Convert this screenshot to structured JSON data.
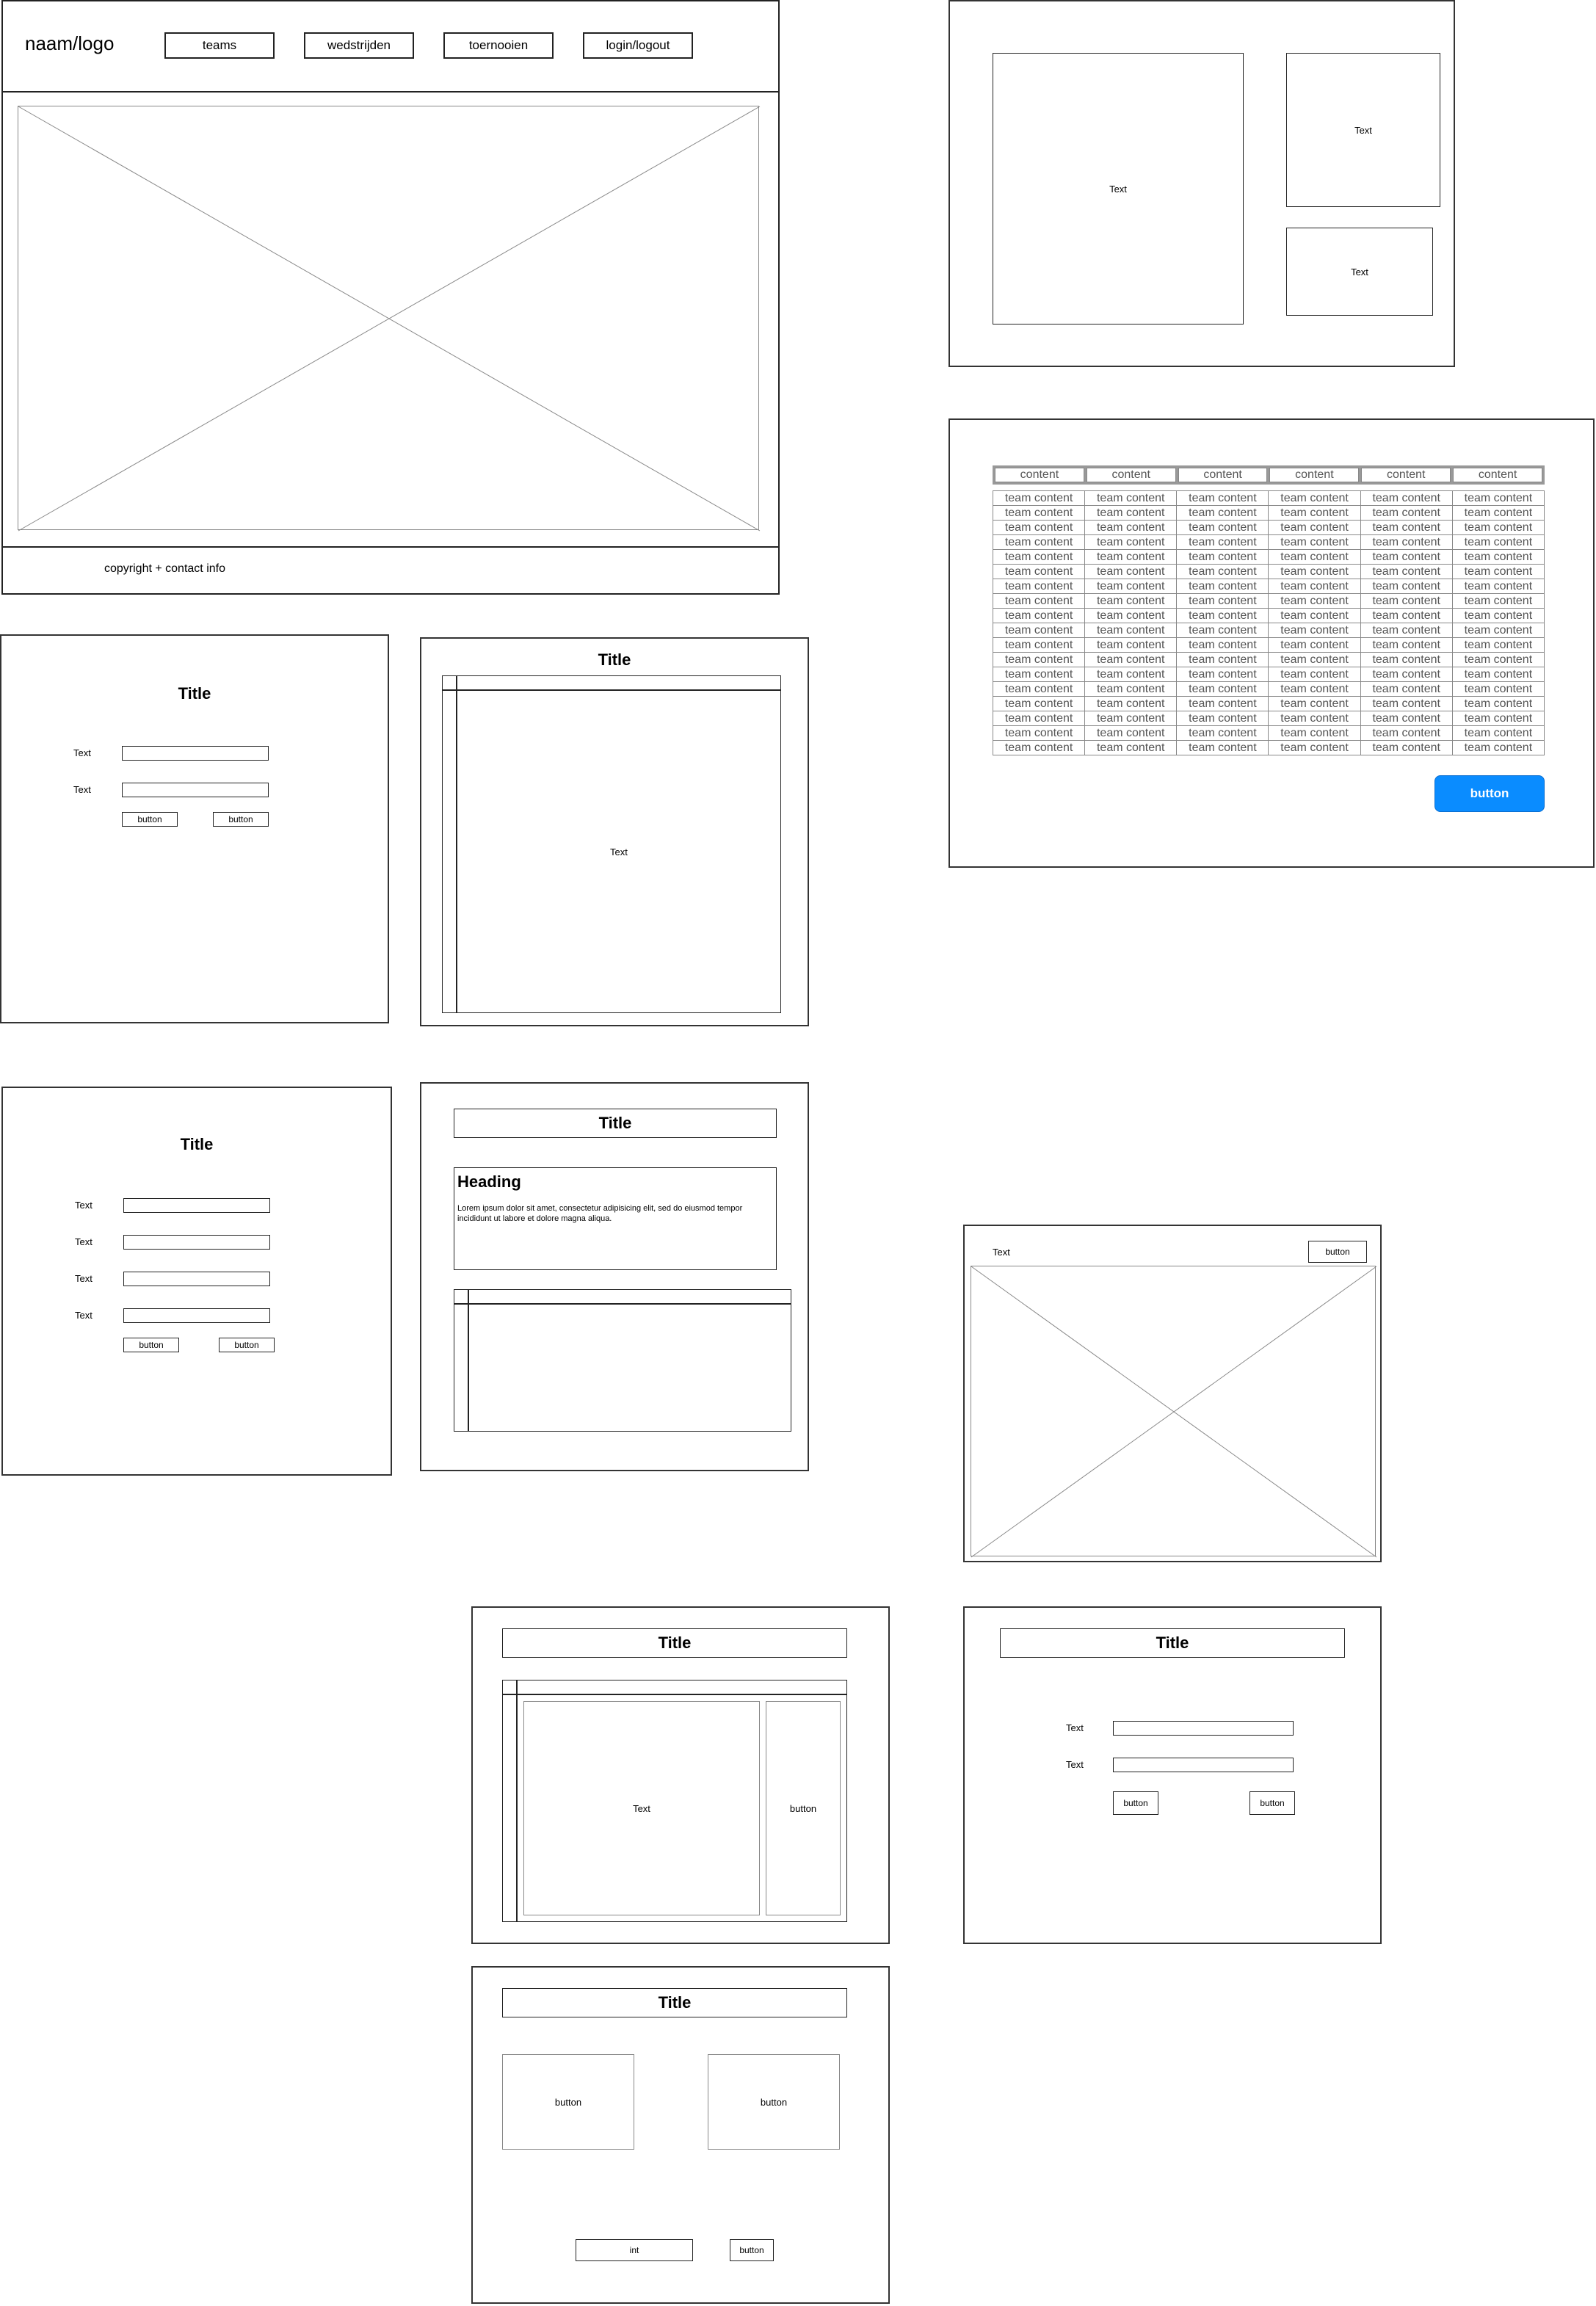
{
  "homepage": {
    "logo": "naam/logo",
    "nav": [
      "teams",
      "wedstrijden",
      "toernooien",
      "login/logout"
    ],
    "footer": "copyright + contact info"
  },
  "layout_panel": {
    "large": "Text",
    "top_right": "Text",
    "bottom_right": "Text"
  },
  "table_panel": {
    "header": [
      "content",
      "content",
      "content",
      "content",
      "content",
      "content"
    ],
    "cell": "team content",
    "row_count": 18,
    "button": "button",
    "button_color": "#0a8cff"
  },
  "login_form": {
    "title": "Title",
    "labels": [
      "Text",
      "Text"
    ],
    "buttons": [
      "button",
      "button"
    ]
  },
  "list_panel": {
    "title": "Title",
    "body": "Text"
  },
  "register_form": {
    "title": "Title",
    "labels": [
      "Text",
      "Text",
      "Text",
      "Text"
    ],
    "buttons": [
      "button",
      "button"
    ]
  },
  "detail_panel": {
    "title": "Title",
    "heading": "Heading",
    "body": "Lorem ipsum dolor sit amet, consectetur adipisicing elit, sed do eiusmod tempor incididunt ut labore et dolore magna aliqua."
  },
  "media_panel": {
    "label": "Text",
    "button": "button"
  },
  "split_panel": {
    "title": "Title",
    "main": "Text",
    "side": "button"
  },
  "small_form": {
    "title": "Title",
    "labels": [
      "Text",
      "Text"
    ],
    "buttons": [
      "button",
      "button"
    ]
  },
  "choice_panel": {
    "title": "Title",
    "option_a": "button",
    "option_b": "button",
    "input": "int",
    "submit": "button"
  }
}
